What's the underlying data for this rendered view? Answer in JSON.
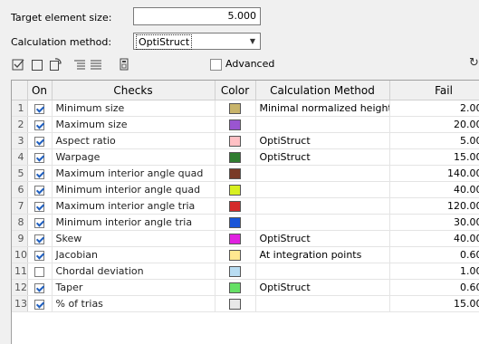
{
  "form": {
    "target_label": "Target element size:",
    "target_value": "5.000",
    "method_label": "Calculation method:",
    "method_value": "OptiStruct",
    "advanced_label": "Advanced",
    "advanced_checked": false
  },
  "toolbar": {
    "icons": [
      "check-all-icon",
      "uncheck-all-icon",
      "reset-icon",
      "expand-icon",
      "collapse-icon",
      "calculator-icon",
      "refresh-icon"
    ]
  },
  "table": {
    "headers": {
      "on": "On",
      "checks": "Checks",
      "color": "Color",
      "method": "Calculation Method",
      "fail": "Fail"
    },
    "rows": [
      {
        "num": "1",
        "on": true,
        "check": "Minimum size",
        "color": "#c8b46a",
        "method": "Minimal normalized height",
        "fail": "2.000"
      },
      {
        "num": "2",
        "on": true,
        "check": "Maximum size",
        "color": "#9a55d0",
        "method": "",
        "fail": "20.000"
      },
      {
        "num": "3",
        "on": true,
        "check": "Aspect ratio",
        "color": "#ffc0c4",
        "method": "OptiStruct",
        "fail": "5.000"
      },
      {
        "num": "4",
        "on": true,
        "check": "Warpage",
        "color": "#2f7d2f",
        "method": "OptiStruct",
        "fail": "15.000"
      },
      {
        "num": "5",
        "on": true,
        "check": "Maximum interior angle quad",
        "color": "#7a3a26",
        "method": "",
        "fail": "140.000"
      },
      {
        "num": "6",
        "on": true,
        "check": "Minimum interior angle quad",
        "color": "#d8f020",
        "method": "",
        "fail": "40.000"
      },
      {
        "num": "7",
        "on": true,
        "check": "Maximum interior angle tria",
        "color": "#d42a2a",
        "method": "",
        "fail": "120.000"
      },
      {
        "num": "8",
        "on": true,
        "check": "Minimum interior angle tria",
        "color": "#1a55d8",
        "method": "",
        "fail": "30.000"
      },
      {
        "num": "9",
        "on": true,
        "check": "Skew",
        "color": "#e020e0",
        "method": "OptiStruct",
        "fail": "40.000"
      },
      {
        "num": "10",
        "on": true,
        "check": "Jacobian",
        "color": "#ffe890",
        "method": "At integration points",
        "fail": "0.600"
      },
      {
        "num": "11",
        "on": false,
        "check": "Chordal deviation",
        "color": "#b8dcf2",
        "method": "",
        "fail": "1.000"
      },
      {
        "num": "12",
        "on": true,
        "check": "Taper",
        "color": "#66e066",
        "method": "OptiStruct",
        "fail": "0.600"
      },
      {
        "num": "13",
        "on": true,
        "check": "% of trias",
        "color": "#e8e8e8",
        "method": "",
        "fail": "15.000"
      }
    ]
  }
}
